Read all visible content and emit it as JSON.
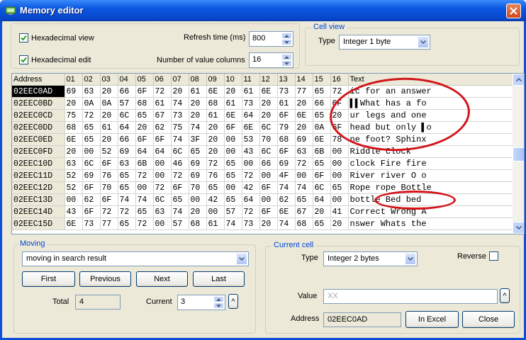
{
  "window": {
    "title": "Memory editor"
  },
  "top": {
    "hex_view_label": "Hexadecimal view",
    "hex_view_checked": true,
    "hex_edit_label": "Hexadecimal edit",
    "hex_edit_checked": true,
    "refresh_label": "Refresh time (ms)",
    "refresh_value": "800",
    "columns_label": "Number of value columns",
    "columns_value": "16"
  },
  "cell_view": {
    "legend": "Cell view",
    "type_label": "Type",
    "type_value": "Integer 1 byte"
  },
  "grid": {
    "headers": [
      "Address",
      "01",
      "02",
      "03",
      "04",
      "05",
      "06",
      "07",
      "08",
      "09",
      "10",
      "11",
      "12",
      "13",
      "14",
      "15",
      "16",
      "Text"
    ],
    "rows": [
      {
        "addr": "02EEC0AD",
        "cells": [
          "69",
          "63",
          "20",
          "66",
          "6F",
          "72",
          "20",
          "61",
          "6E",
          "20",
          "61",
          "6E",
          "73",
          "77",
          "65",
          "72"
        ],
        "text": "ic for an answer"
      },
      {
        "addr": "02EEC0BD",
        "cells": [
          "20",
          "0A",
          "0A",
          "57",
          "68",
          "61",
          "74",
          "20",
          "68",
          "61",
          "73",
          "20",
          "61",
          "20",
          "66",
          "6F"
        ],
        "text": " ▌▌What has a fo"
      },
      {
        "addr": "02EEC0CD",
        "cells": [
          "75",
          "72",
          "20",
          "6C",
          "65",
          "67",
          "73",
          "20",
          "61",
          "6E",
          "64",
          "20",
          "6F",
          "6E",
          "65",
          "20"
        ],
        "text": "ur legs and one "
      },
      {
        "addr": "02EEC0DD",
        "cells": [
          "68",
          "65",
          "61",
          "64",
          "20",
          "62",
          "75",
          "74",
          "20",
          "6F",
          "6E",
          "6C",
          "79",
          "20",
          "0A",
          "6F"
        ],
        "text": "head but only ▌o"
      },
      {
        "addr": "02EEC0ED",
        "cells": [
          "6E",
          "65",
          "20",
          "66",
          "6F",
          "6F",
          "74",
          "3F",
          "20",
          "00",
          "53",
          "70",
          "68",
          "69",
          "6E",
          "78"
        ],
        "text": "ne foot?  Sphinx"
      },
      {
        "addr": "02EEC0FD",
        "cells": [
          "20",
          "00",
          "52",
          "69",
          "64",
          "64",
          "6C",
          "65",
          "20",
          "00",
          "43",
          "6C",
          "6F",
          "63",
          "6B",
          "00"
        ],
        "text": "  Riddle  Clock "
      },
      {
        "addr": "02EEC10D",
        "cells": [
          "63",
          "6C",
          "6F",
          "63",
          "6B",
          "00",
          "46",
          "69",
          "72",
          "65",
          "00",
          "66",
          "69",
          "72",
          "65",
          "00"
        ],
        "text": "clock Fire fire "
      },
      {
        "addr": "02EEC11D",
        "cells": [
          "52",
          "69",
          "76",
          "65",
          "72",
          "00",
          "72",
          "69",
          "76",
          "65",
          "72",
          "00",
          "4F",
          "00",
          "6F",
          "00"
        ],
        "text": "River river O o "
      },
      {
        "addr": "02EEC12D",
        "cells": [
          "52",
          "6F",
          "70",
          "65",
          "00",
          "72",
          "6F",
          "70",
          "65",
          "00",
          "42",
          "6F",
          "74",
          "74",
          "6C",
          "65"
        ],
        "text": "Rope rope Bottle"
      },
      {
        "addr": "02EEC13D",
        "cells": [
          "00",
          "62",
          "6F",
          "74",
          "74",
          "6C",
          "65",
          "00",
          "42",
          "65",
          "64",
          "00",
          "62",
          "65",
          "64",
          "00"
        ],
        "text": " bottle Bed bed "
      },
      {
        "addr": "02EEC14D",
        "cells": [
          "43",
          "6F",
          "72",
          "72",
          "65",
          "63",
          "74",
          "20",
          "00",
          "57",
          "72",
          "6F",
          "6E",
          "67",
          "20",
          "41"
        ],
        "text": "Correct  Wrong A"
      },
      {
        "addr": "02EEC15D",
        "cells": [
          "6E",
          "73",
          "77",
          "65",
          "72",
          "00",
          "57",
          "68",
          "61",
          "74",
          "73",
          "20",
          "74",
          "68",
          "65",
          "20"
        ],
        "text": "nswer Whats the "
      }
    ]
  },
  "moving": {
    "legend": "Moving",
    "mode_value": "moving in search result",
    "first_label": "First",
    "previous_label": "Previous",
    "next_label": "Next",
    "last_label": "Last",
    "total_label": "Total",
    "total_value": "4",
    "current_label": "Current",
    "current_value": "3",
    "current_step_label": "^"
  },
  "current_cell": {
    "legend": "Current cell",
    "type_label": "Type",
    "type_value": "Integer 2 bytes",
    "reverse_label": "Reverse",
    "reverse_checked": false,
    "value_label": "Value",
    "value_value": "XX",
    "value_step_label": "^",
    "address_label": "Address",
    "address_value": "02EEC0AD",
    "in_excel_label": "In Excel",
    "close_label": "Close"
  },
  "colors": {
    "title_bar": "#0A56E2",
    "legend_text": "#0046D5",
    "annotation": "#D2141A",
    "selected_cell_bg": "#000000"
  }
}
